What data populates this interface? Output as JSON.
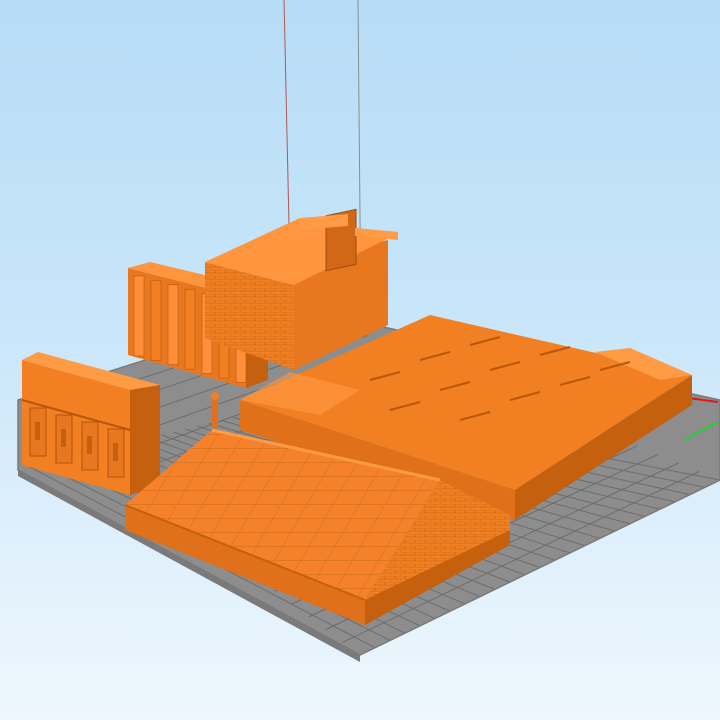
{
  "viewport": {
    "background_top": "#b6dcf6",
    "background_bottom": "#eef7fd",
    "model_color": "#f27f22",
    "model_shadow": "#c5600f",
    "model_highlight": "#ff9a45",
    "grid_color": "#6c6c6c",
    "grid_background": "#8a8a8a"
  },
  "scene": {
    "description_icons": [
      "build-plate-grid",
      "x-axis-indicator",
      "y-axis-indicator",
      "z-axis-guide-lines"
    ],
    "axis_colors": {
      "x": "#e01818",
      "y": "#22d030"
    },
    "objects": [
      "left-temple-facade",
      "colonnade-wall",
      "gate-wall",
      "raised-platform",
      "sloped-roof-block",
      "small-statue"
    ]
  }
}
